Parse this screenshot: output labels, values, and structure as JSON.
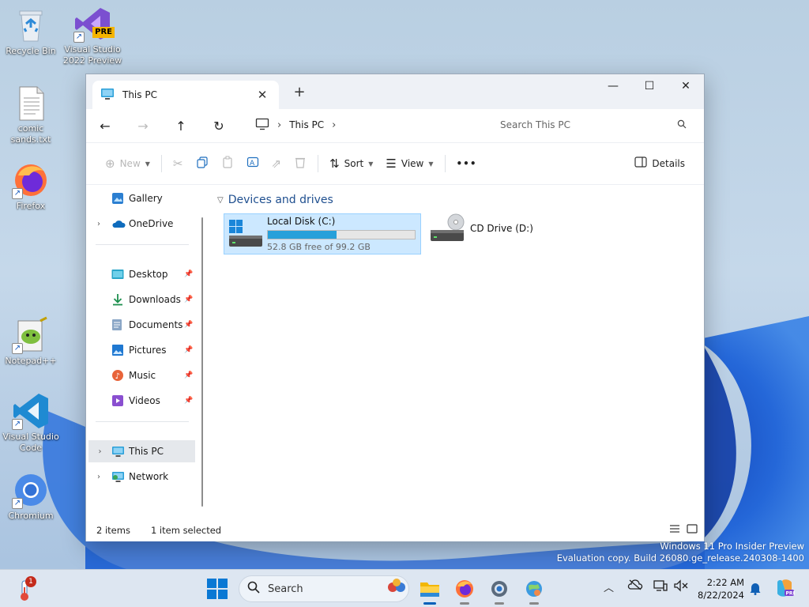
{
  "desktop": {
    "icons": [
      {
        "label": "Recycle Bin",
        "icon": "recycle-bin-icon"
      },
      {
        "label": "Visual Studio 2022 Preview",
        "icon": "visual-studio-icon",
        "badge": "PRE"
      },
      {
        "label": "comic sands.txt",
        "icon": "text-file-icon"
      },
      {
        "label": "Firefox",
        "icon": "firefox-icon"
      },
      {
        "label": "Notepad++",
        "icon": "notepad-plus-plus-icon"
      },
      {
        "label": "Visual Studio Code",
        "icon": "vscode-icon"
      },
      {
        "label": "Chromium",
        "icon": "chromium-icon"
      }
    ],
    "watermark": {
      "line1": "Windows 11 Pro Insider Preview",
      "line2": "Evaluation copy. Build 26080.ge_release.240308-1400"
    }
  },
  "explorer": {
    "tab": {
      "title": "This PC",
      "close": "✕",
      "new_tab": "+"
    },
    "window_controls": {
      "minimize": "—",
      "maximize": "☐",
      "close": "✕"
    },
    "nav": {
      "address": {
        "location": "This PC",
        "separator": "›"
      },
      "search_placeholder": "Search This PC"
    },
    "commands": {
      "new": "New",
      "sort": "Sort",
      "view": "View",
      "more": "•••",
      "details": "Details"
    },
    "sidebar": {
      "top": [
        {
          "label": "Gallery",
          "expandable": false
        },
        {
          "label": "OneDrive",
          "expandable": true
        }
      ],
      "quick_access": [
        {
          "label": "Desktop",
          "pinned": true
        },
        {
          "label": "Downloads",
          "pinned": true
        },
        {
          "label": "Documents",
          "pinned": true
        },
        {
          "label": "Pictures",
          "pinned": true
        },
        {
          "label": "Music",
          "pinned": true
        },
        {
          "label": "Videos",
          "pinned": true
        }
      ],
      "locations": [
        {
          "label": "This PC",
          "selected": true
        },
        {
          "label": "Network",
          "selected": false
        }
      ]
    },
    "content": {
      "group_title": "Devices and drives",
      "drives": [
        {
          "name": "Local Disk (C:)",
          "free_text": "52.8 GB free of 99.2 GB",
          "used_fraction": 0.468,
          "selected": true
        },
        {
          "name": "CD Drive (D:)",
          "selected": false
        }
      ]
    },
    "status": {
      "items": "2 items",
      "selected": "1 item selected"
    }
  },
  "taskbar": {
    "widgets_badge": "1",
    "search_label": "Search",
    "clock": {
      "time": "2:22 AM",
      "date": "8/22/2024"
    },
    "colors": {
      "accent": "#005fb8",
      "badge": "#c42b1c"
    }
  }
}
